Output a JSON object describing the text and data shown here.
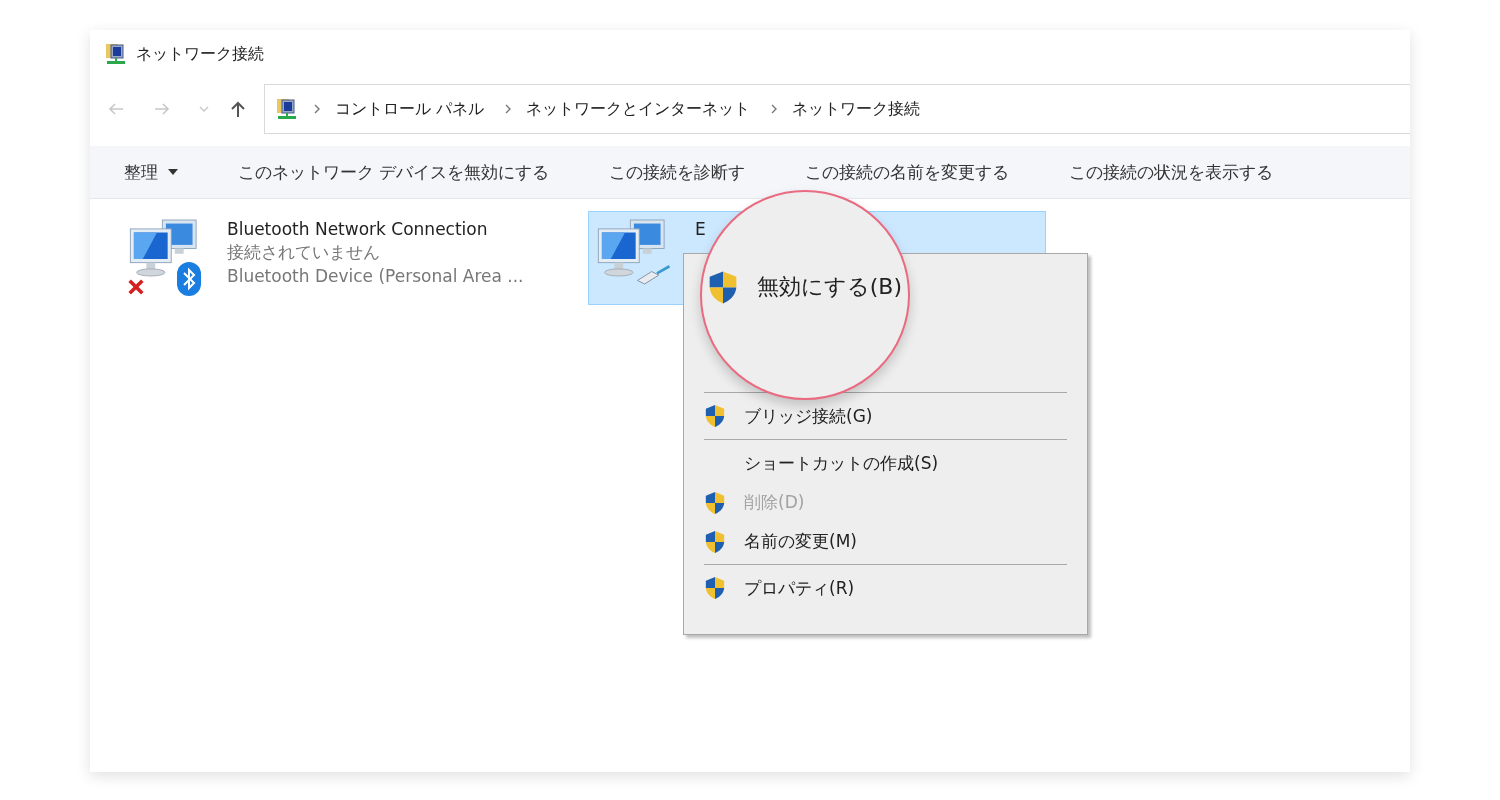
{
  "window": {
    "title": "ネットワーク接続"
  },
  "address": {
    "breadcrumbs": [
      "コントロール パネル",
      "ネットワークとインターネット",
      "ネットワーク接続"
    ]
  },
  "toolbar": [
    {
      "label": "整理",
      "kind": "dropdown"
    },
    {
      "label": "このネットワーク デバイスを無効にする",
      "kind": "command"
    },
    {
      "label": "この接続を診断す",
      "kind": "command"
    },
    {
      "label": "この接続の名前を変更する",
      "kind": "command"
    },
    {
      "label": "この接続の状況を表示する",
      "kind": "command"
    }
  ],
  "connections": [
    {
      "kind": "bluetooth",
      "name": "Bluetooth Network Connection",
      "status": "接続されていません",
      "device": "Bluetooth Device (Personal Area ...",
      "disconnected": true,
      "selected": false
    },
    {
      "kind": "ethernet",
      "name": "E",
      "disconnected": false,
      "selected": true
    }
  ],
  "context_menu": {
    "items": [
      {
        "kind": "separator"
      },
      {
        "kind": "item",
        "label": "ブリッジ接続(G)",
        "shield": true,
        "disabled": false
      },
      {
        "kind": "separator"
      },
      {
        "kind": "item",
        "label": "ショートカットの作成(S)",
        "shield": false,
        "disabled": false
      },
      {
        "kind": "item",
        "label": "削除(D)",
        "shield": true,
        "disabled": true
      },
      {
        "kind": "item",
        "label": "名前の変更(M)",
        "shield": true,
        "disabled": false
      },
      {
        "kind": "separator"
      },
      {
        "kind": "item",
        "label": "プロパティ(R)",
        "shield": true,
        "disabled": false
      }
    ]
  },
  "magnifier": {
    "label": "無効にする(B)",
    "shield": true
  }
}
